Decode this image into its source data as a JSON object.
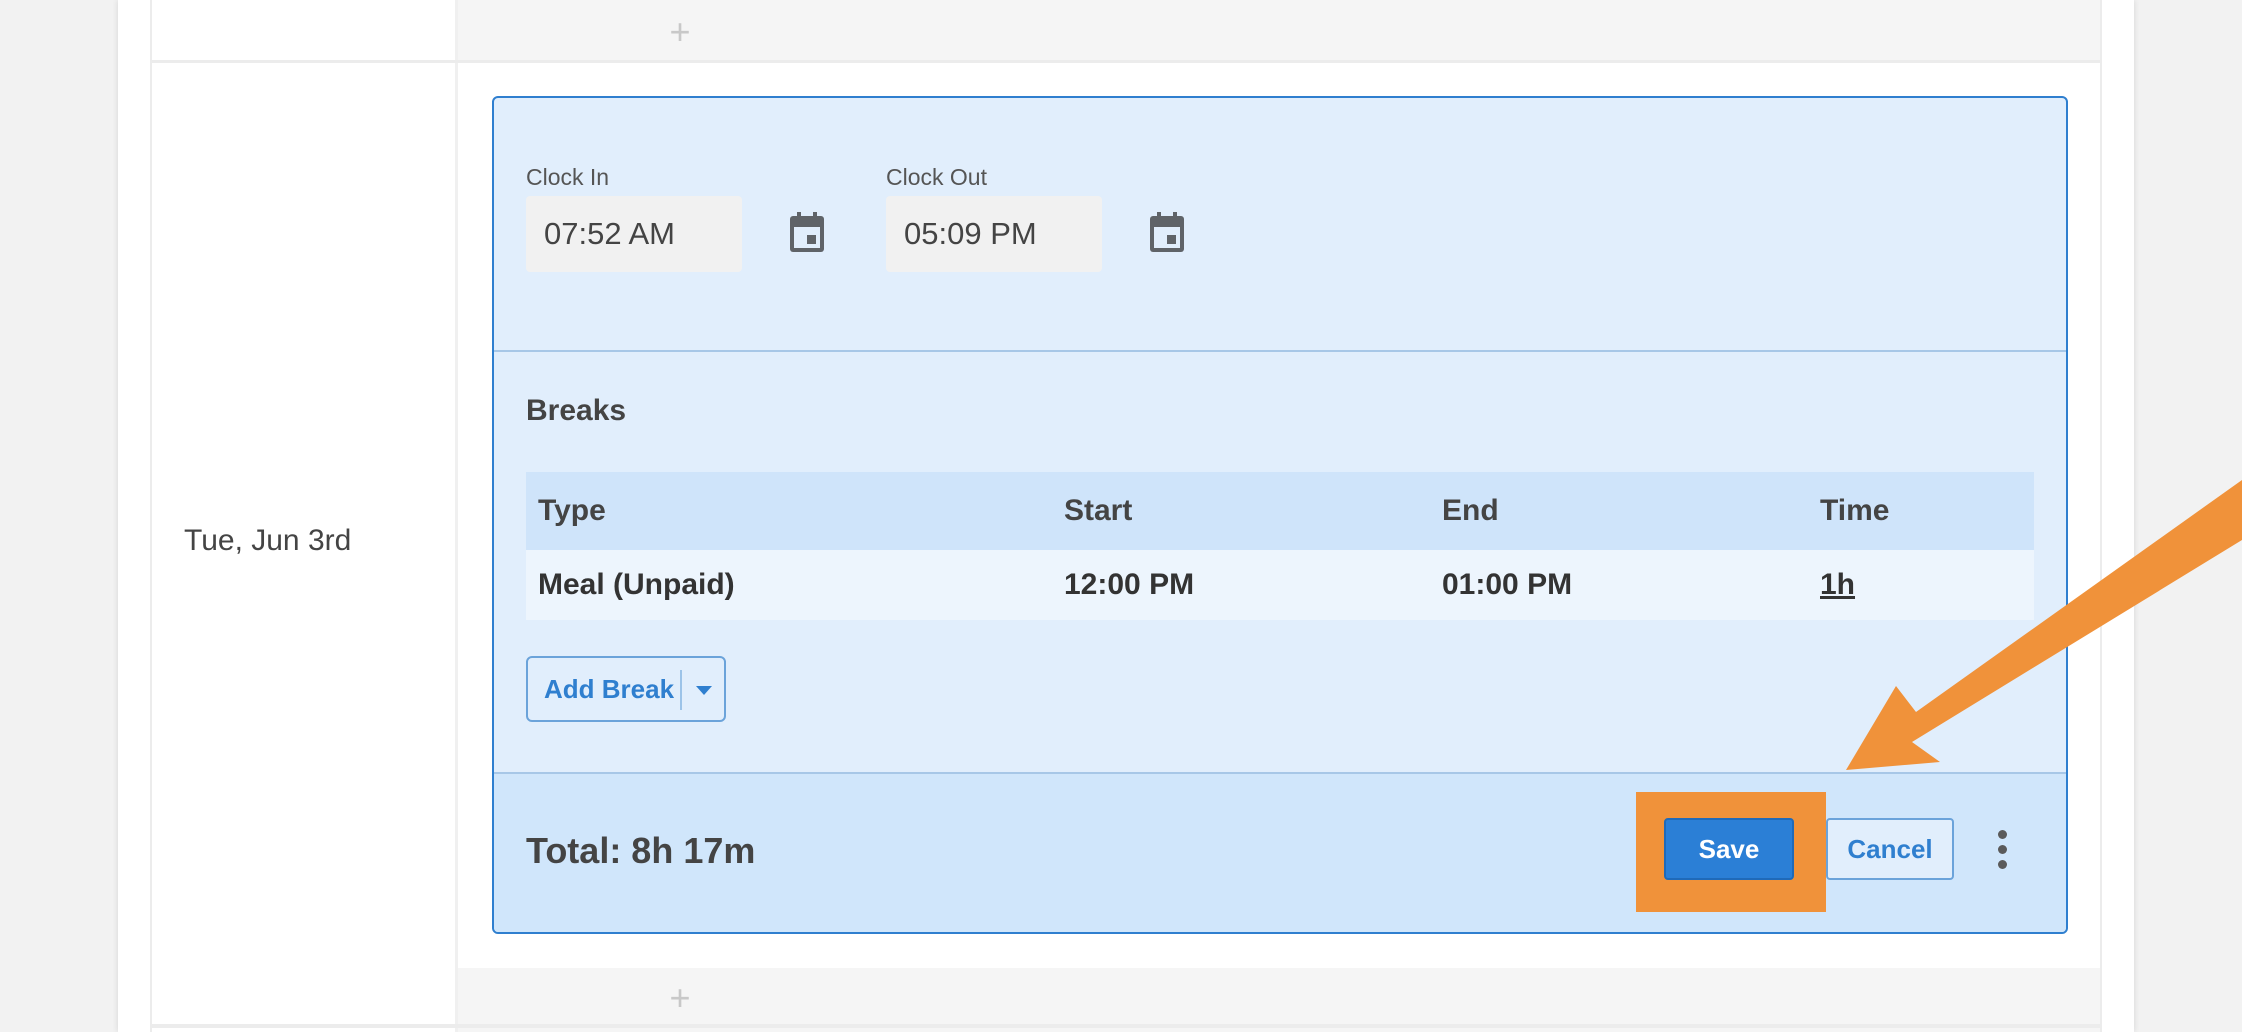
{
  "grid": {
    "add_top": "+",
    "add_bottom": "+"
  },
  "day": {
    "label": "Tue, Jun 3rd"
  },
  "clock": {
    "in_label": "Clock In",
    "in_value": "07:52 AM",
    "out_label": "Clock Out",
    "out_value": "05:09 PM",
    "calendar_icon": "calendar-icon"
  },
  "breaks": {
    "title": "Breaks",
    "columns": [
      "Type",
      "Start",
      "End",
      "Time"
    ],
    "rows": [
      {
        "type": "Meal (Unpaid)",
        "start": "12:00 PM",
        "end": "01:00 PM",
        "time": "1h"
      }
    ],
    "add_label": "Add Break"
  },
  "footer": {
    "total": "Total: 8h 17m",
    "save_label": "Save",
    "cancel_label": "Cancel",
    "more_icon": "more-vertical-icon"
  },
  "colors": {
    "accent": "#2b7fd6",
    "highlight": "#f0923a",
    "panel": "#e1eefc"
  }
}
